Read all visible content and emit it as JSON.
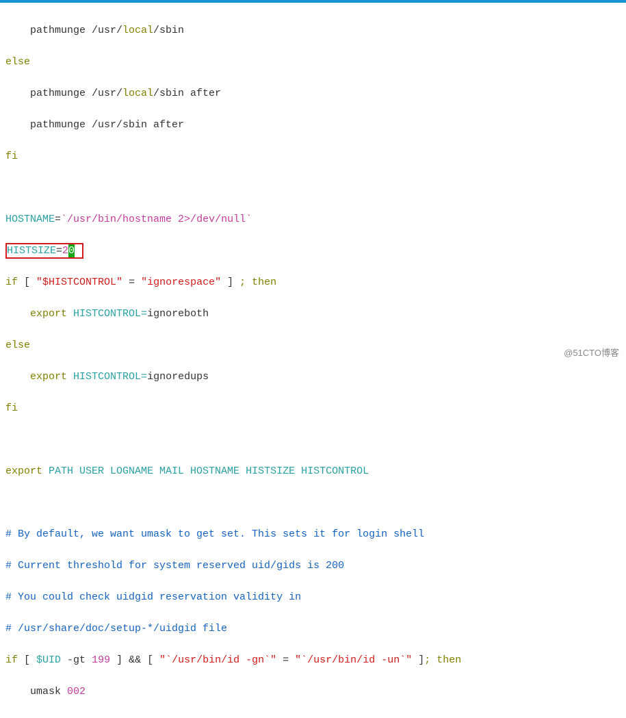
{
  "code": {
    "l1a": "    pathmunge /usr/",
    "l1b": "local",
    "l1c": "/sbin",
    "l2": "else",
    "l3a": "    pathmunge /usr/",
    "l3b": "local",
    "l3c": "/sbin after",
    "l4": "    pathmunge /usr/sbin after",
    "l5": "fi",
    "blank1": " ",
    "l6a": "HOSTNAME",
    "l6b": "=",
    "l6c": "`/usr/bin/hostname 2>/dev/null`",
    "l7a": "HISTSIZE",
    "l7b": "=",
    "l7c": "2",
    "l7d": "0",
    "l7e": " ",
    "l8a": "if",
    "l8b": " [ ",
    "l8c": "\"$HISTCONTROL\"",
    "l8d": " = ",
    "l8e": "\"ignorespace\"",
    "l8f": " ] ",
    "l8g": ";",
    "l8h": " then",
    "l9a": "    ",
    "l9b": "export",
    "l9c": " HISTCONTROL=",
    "l9d": "ignoreboth",
    "l10": "else",
    "l11a": "    ",
    "l11b": "export",
    "l11c": " HISTCONTROL=",
    "l11d": "ignoredups",
    "l12": "fi",
    "blank2": " ",
    "l13a": "export",
    "l13b": " PATH USER LOGNAME MAIL HOSTNAME HISTSIZE HISTCONTROL",
    "blank3": " ",
    "l14": "# By default, we want umask to get set. This sets it for login shell",
    "l15": "# Current threshold for system reserved uid/gids is 200",
    "l16": "# You could check uidgid reservation validity in",
    "l17": "# /usr/share/doc/setup-*/uidgid file",
    "l18a": "if",
    "l18b": " [ ",
    "l18c": "$UID",
    "l18d": " -gt ",
    "l18e": "199",
    "l18f": " ] ",
    "l18g": "&&",
    "l18h": " [ ",
    "l18i": "\"`/usr/bin/id -gn`\"",
    "l18j": " = ",
    "l18k": "\"`/usr/bin/id -un`\"",
    "l18l": " ]",
    "l18m": ";",
    "l18n": " then",
    "l19a": "    umask ",
    "l19b": "002"
  },
  "watermark": "@51CTO博客"
}
